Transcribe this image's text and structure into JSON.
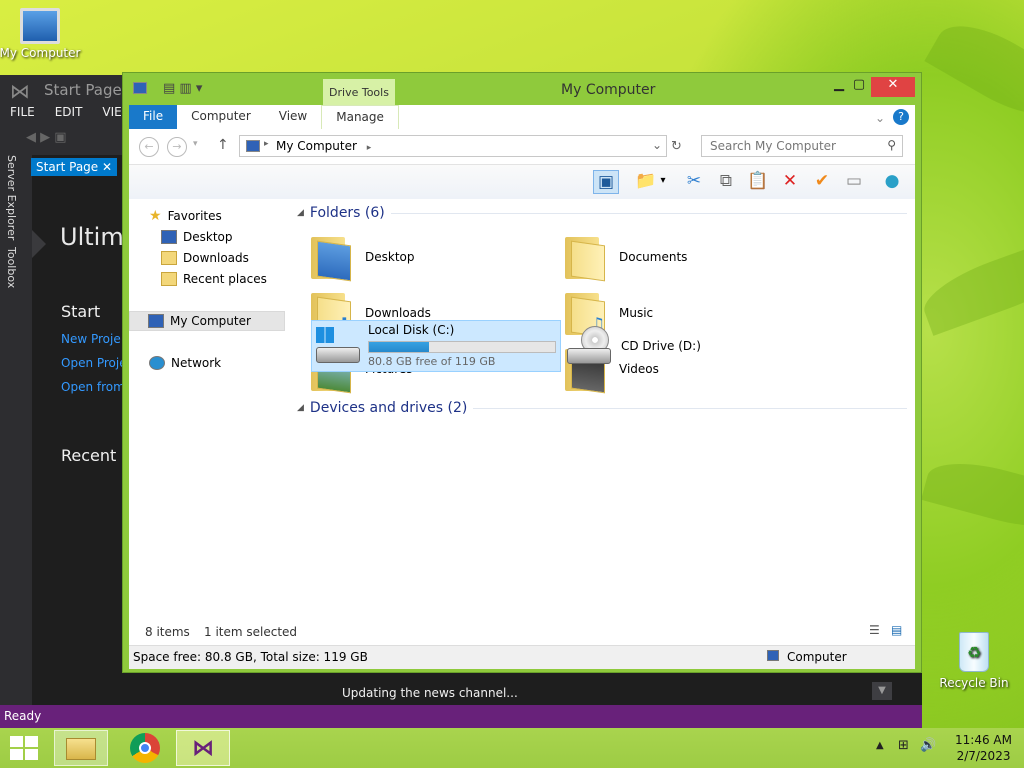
{
  "desktop": {
    "mycomputer_label": "My Computer",
    "recyclebin_label": "Recycle Bin"
  },
  "vs": {
    "title": "Start Page -",
    "menu": [
      "FILE",
      "EDIT",
      "VIEW"
    ],
    "side_tabs": [
      "Server Explorer",
      "Toolbox"
    ],
    "doc_tab": "Start Page",
    "heading": "Ultima",
    "start": "Start",
    "links": [
      "New Proje",
      "Open Proje",
      "Open from"
    ],
    "recent": "Recent",
    "news": "Updating the news channel...",
    "status": "Ready"
  },
  "explorer": {
    "title": "My Computer",
    "context_tab": "Drive Tools",
    "ribbon_tabs": [
      "File",
      "Computer",
      "View",
      "Manage"
    ],
    "address": "My Computer",
    "search_placeholder": "Search My Computer",
    "nav": {
      "favorites": "Favorites",
      "desktop": "Desktop",
      "downloads": "Downloads",
      "recent": "Recent places",
      "computer": "My Computer",
      "network": "Network"
    },
    "folders_header": "Folders (6)",
    "folders": [
      "Desktop",
      "Documents",
      "Downloads",
      "Music",
      "Pictures",
      "Videos"
    ],
    "drives_header": "Devices and drives (2)",
    "drive_c": {
      "name": "Local Disk (C:)",
      "free": "80.8 GB free of 119 GB",
      "used_fraction": 0.32
    },
    "drive_d": {
      "name": "CD Drive (D:)"
    },
    "status_items": "8 items",
    "status_selected": "1 item selected",
    "details": "Space free: 80.8 GB, Total size: 119 GB",
    "details_right": "Computer"
  },
  "taskbar": {
    "time": "11:46 AM",
    "date": "2/7/2023"
  }
}
